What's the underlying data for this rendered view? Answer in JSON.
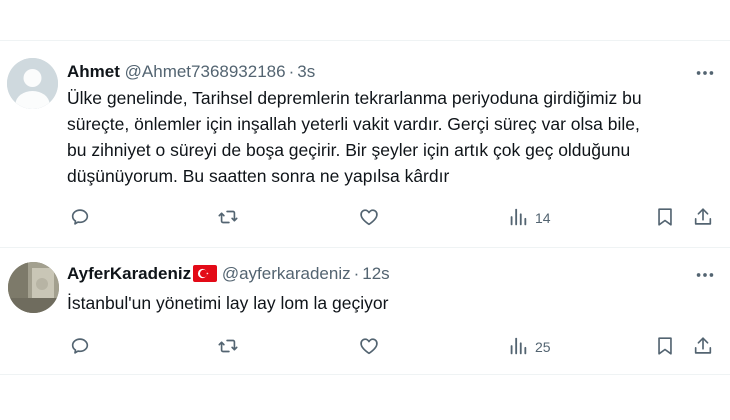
{
  "tweets": [
    {
      "name": "Ahmet",
      "handle": "@Ahmet7368932186",
      "separator": "·",
      "time": "3s",
      "text": "Ülke genelinde, Tarihsel depremlerin tekrarlanma periyoduna girdiğimiz bu\nsüreçte, önlemler için inşallah yeterli vakit vardır. Gerçi süreç var olsa bile,\nbu zihniyet o süreyi de boşa geçirir. Bir şeyler için artık çok geç olduğunu\ndüşünüyorum. Bu saatten sonra ne yapılsa kârdır",
      "views": "14",
      "icons": [
        "reply-icon",
        "retweet-icon",
        "like-icon",
        "views-icon",
        "bookmark-icon",
        "share-icon",
        "more-icon"
      ]
    },
    {
      "name": "AyferKaradeniz",
      "handle": "@ayferkaradeniz",
      "separator": "·",
      "time": "12s",
      "text": "İstanbul'un yönetimi lay lay lom la geçiyor",
      "views": "25",
      "flag": "turkey-flag-icon",
      "icons": [
        "reply-icon",
        "retweet-icon",
        "like-icon",
        "views-icon",
        "bookmark-icon",
        "share-icon",
        "more-icon"
      ]
    }
  ],
  "colors": {
    "text": "#0f1419",
    "secondary": "#536471",
    "border": "#eff3f4",
    "flag_red": "#e30a17"
  }
}
